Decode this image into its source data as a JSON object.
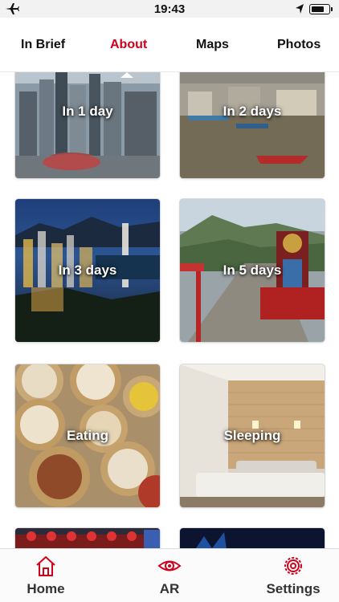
{
  "status_bar": {
    "time": "19:43",
    "airplane_icon": "airplane-icon",
    "location_icon": "location-arrow-icon",
    "battery_icon": "battery-icon",
    "battery_level": 0.8
  },
  "tabs": [
    {
      "label": "In Brief",
      "active": false
    },
    {
      "label": "About",
      "active": true
    },
    {
      "label": "Maps",
      "active": false
    },
    {
      "label": "Photos",
      "active": false
    }
  ],
  "cards": [
    {
      "label": "In 1 day"
    },
    {
      "label": "In 2 days"
    },
    {
      "label": "In 3 days"
    },
    {
      "label": "In 5 days"
    },
    {
      "label": "Eating"
    },
    {
      "label": "Sleeping"
    }
  ],
  "bottom_nav": [
    {
      "label": "Home",
      "icon": "home-icon"
    },
    {
      "label": "AR",
      "icon": "eye-icon"
    },
    {
      "label": "Settings",
      "icon": "gear-icon"
    }
  ],
  "colors": {
    "accent": "#d0021b",
    "text": "#111111",
    "nav_text": "#333333"
  }
}
